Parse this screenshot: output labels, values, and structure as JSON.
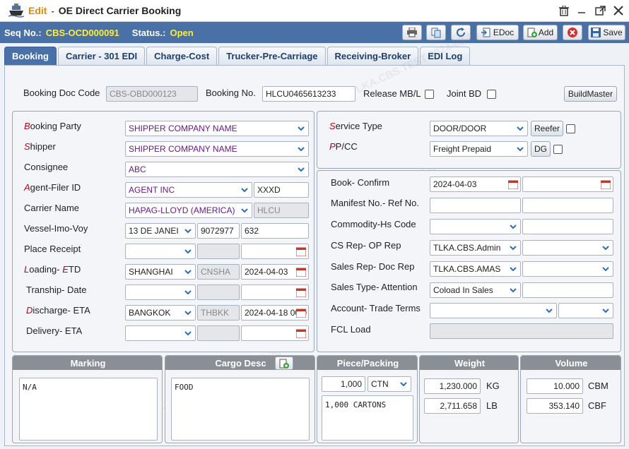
{
  "titlebar": {
    "mode": "Edit",
    "separator": "-",
    "title": "OE Direct Carrier Booking"
  },
  "seqbar": {
    "seq_label": "Seq No.:",
    "seq_value": "CBS-OCD000091",
    "status_label": "Status.:",
    "status_value": "Open"
  },
  "toolbar": {
    "edoc_label": "EDoc",
    "add_label": "Add",
    "save_label": "Save"
  },
  "tabs": [
    "Booking",
    "Carrier - 301 EDI",
    "Charge-Cost",
    "Trucker-Pre-Carriage",
    "Receiving-Broker",
    "EDI Log"
  ],
  "watermark": "TLKA.CBS.TEST 2024-08-26",
  "header": {
    "booking_doc_code_label": "Booking Doc Code",
    "booking_doc_code": "CBS-OBD000123",
    "booking_no_label": "Booking No.",
    "booking_no": "HLCU0465613233",
    "release_label": "Release MB/L",
    "joint_label": "Joint BD",
    "buildmaster_label": "BuildMaster"
  },
  "left": {
    "booking_party_first": "B",
    "booking_party_rest": "ooking Party",
    "booking_party": "SHIPPER COMPANY NAME",
    "shipper_first": "S",
    "shipper_rest": "hipper",
    "shipper": "SHIPPER COMPANY NAME",
    "consignee_label": "Consignee",
    "consignee": "ABC",
    "agent_first": "A",
    "agent_rest": "gent-Filer ID",
    "agent": "AGENT INC",
    "filer_id": "XXXD",
    "carrier_label": "Carrier Name",
    "carrier": "HAPAG-LLOYD (AMERICA)",
    "carrier_code": "HLCU",
    "vessel_label": "Vessel-Imo-Voy",
    "vessel": "13 DE JANEI",
    "imo": "9072977",
    "voy": "632",
    "place_receipt_label": "Place Receipt",
    "loading_first": "L",
    "loading_mid": "oading- ",
    "loading_e": "E",
    "loading_rest": "TD",
    "loading": "SHANGHAI",
    "loading_code": "CNSHA",
    "etd": "2024-04-03",
    "tranship_label": "Tranship- Date",
    "discharge_first": "D",
    "discharge_rest": "ischarge- ETA",
    "discharge": "BANGKOK",
    "discharge_code": "THBKK",
    "eta": "2024-04-18 00:0",
    "delivery_label": "Delivery- ETA"
  },
  "right": {
    "service_first": "S",
    "service_rest": "ervice Type",
    "service_type": "DOOR/DOOR",
    "reefer_label": "Reefer",
    "ppcc_first": "P",
    "ppcc_rest": "P/CC",
    "ppcc": "Freight Prepaid",
    "dg_label": "DG",
    "book_confirm_label": "Book- Confirm",
    "book_date": "2024-04-03",
    "manifest_label": "Manifest No.- Ref No.",
    "commodity_label": "Commodity-Hs Code",
    "csrep_label": "CS Rep- OP Rep",
    "csrep": "TLKA.CBS.Admin",
    "salesrep_label": "Sales Rep- Doc Rep",
    "salesrep": "TLKA.CBS.AMAS",
    "salestype_label": "Sales Type- Attention",
    "salestype": "Coload In Sales",
    "account_label": "Account- Trade Terms",
    "fcl_label": "FCL Load"
  },
  "cargo": {
    "marking_head": "Marking",
    "marking": "N/A",
    "desc_head": "Cargo Desc",
    "desc": "FOOD",
    "piece_head": "Piece/Packing",
    "pieces": "1,000",
    "packing": "CTN",
    "piece_text": "1,000 CARTONS",
    "weight_head": "Weight",
    "weight_kg": "1,230.000",
    "kg_unit": "KG",
    "weight_lb": "2,711.658",
    "lb_unit": "LB",
    "volume_head": "Volume",
    "volume_cbm": "10.000",
    "cbm_unit": "CBM",
    "volume_cbf": "353.140",
    "cbf_unit": "CBF"
  },
  "colors": {
    "accent": "#4a70a8",
    "seq_value": "#ffee33",
    "mode": "#e28a00",
    "required": "#c0001a",
    "dropdown_text": "#6a1a8a"
  }
}
